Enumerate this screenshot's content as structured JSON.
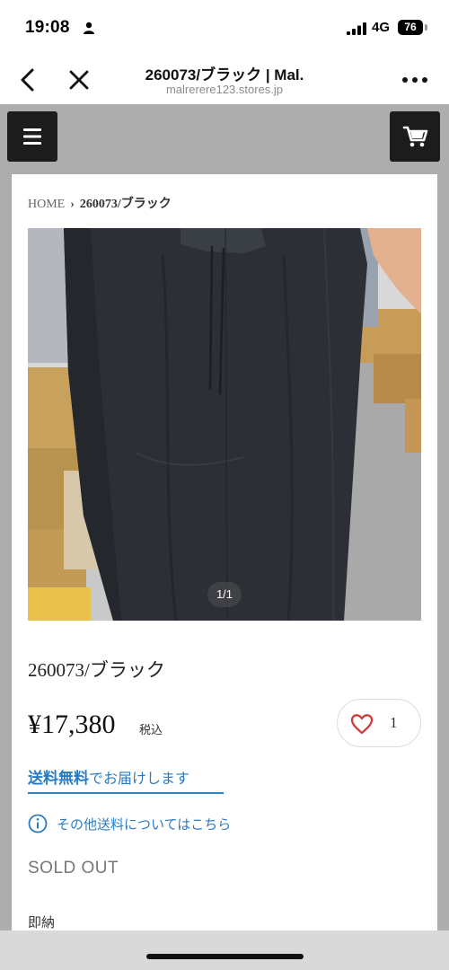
{
  "status_bar": {
    "time": "19:08",
    "network": "4G",
    "battery": "76"
  },
  "browser": {
    "title": "260073/ブラック | Mal.",
    "url": "malrerere123.stores.jp"
  },
  "breadcrumb": {
    "home": "HOME",
    "current": "260073/ブラック"
  },
  "gallery": {
    "counter": "1/1"
  },
  "product": {
    "name": "260073/ブラック",
    "price": "¥17,380",
    "tax_note": "税込",
    "favorite_count": "1",
    "shipping_highlight": "送料無料",
    "shipping_suffix": "でお届けします",
    "shipping_info": "その他送料についてはこちら",
    "status": "SOLD OUT",
    "note": "即納"
  },
  "colors": {
    "accent": "#2a7cc2",
    "heart": "#d23a3a",
    "header_button": "#1c1c1c"
  },
  "icons": {
    "status": [
      "person-icon",
      "signal-icon"
    ],
    "browser": [
      "back-icon",
      "close-icon",
      "more-icon"
    ],
    "store": [
      "hamburger-menu-icon",
      "cart-icon"
    ],
    "product": [
      "heart-icon",
      "info-icon"
    ]
  }
}
